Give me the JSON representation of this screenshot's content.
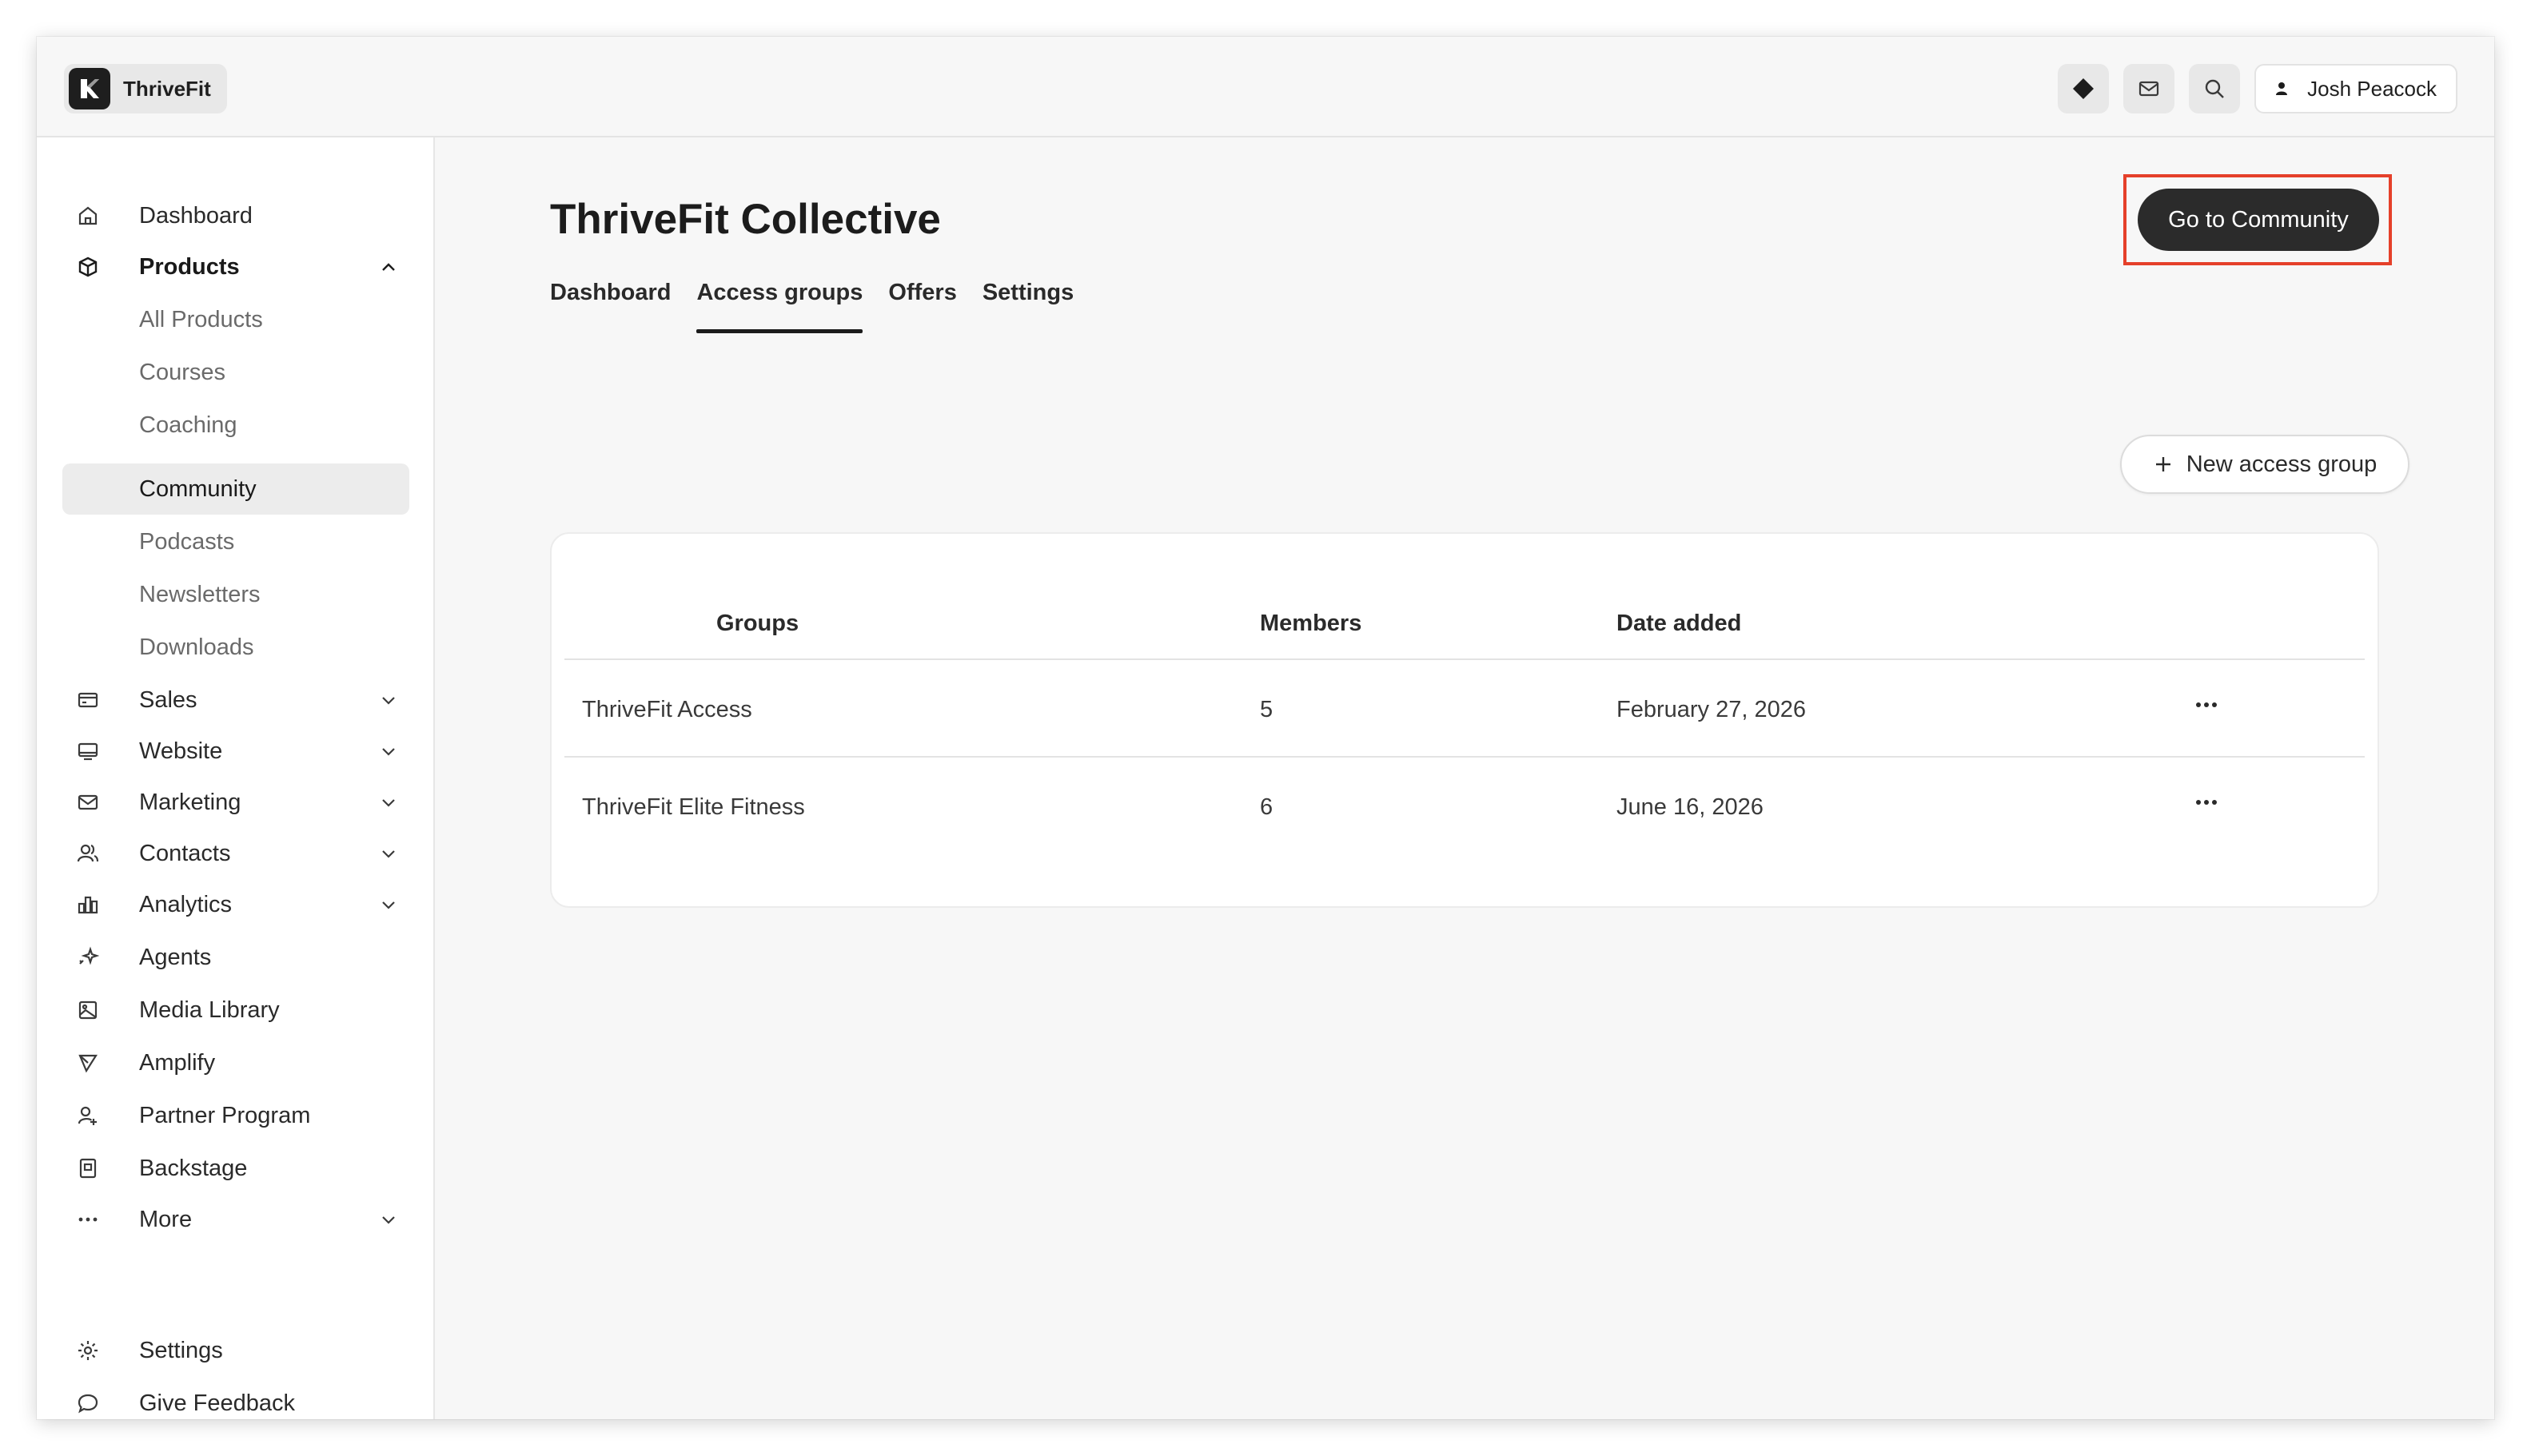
{
  "app": {
    "brand_name": "ThriveFit",
    "user_name": "Josh Peacock"
  },
  "sidebar": {
    "items": [
      {
        "label": "Dashboard",
        "icon": "home-icon"
      },
      {
        "label": "Products",
        "icon": "box-icon",
        "expanded": true
      },
      {
        "label": "Sales",
        "icon": "credit-card-icon"
      },
      {
        "label": "Website",
        "icon": "monitor-icon"
      },
      {
        "label": "Marketing",
        "icon": "mail-icon"
      },
      {
        "label": "Contacts",
        "icon": "users-icon"
      },
      {
        "label": "Analytics",
        "icon": "bar-chart-icon"
      },
      {
        "label": "Agents",
        "icon": "sparkles-icon"
      },
      {
        "label": "Media Library",
        "icon": "image-icon"
      },
      {
        "label": "Amplify",
        "icon": "send-icon"
      },
      {
        "label": "Partner Program",
        "icon": "partner-icon"
      },
      {
        "label": "Backstage",
        "icon": "backstage-icon"
      },
      {
        "label": "More",
        "icon": "more-dots-icon"
      },
      {
        "label": "Settings",
        "icon": "gear-icon"
      },
      {
        "label": "Give Feedback",
        "icon": "chat-bubble-icon"
      }
    ],
    "product_subitems": [
      "All Products",
      "Courses",
      "Coaching",
      "Community",
      "Podcasts",
      "Newsletters",
      "Downloads"
    ],
    "active_subitem": "Community"
  },
  "main": {
    "title": "ThriveFit Collective",
    "cta_label": "Go to Community",
    "tabs": [
      "Dashboard",
      "Access groups",
      "Offers",
      "Settings"
    ],
    "active_tab": "Access groups",
    "new_group_label": "New access group",
    "table": {
      "headers": [
        "Groups",
        "Members",
        "Date added"
      ],
      "rows": [
        {
          "group": "ThriveFit Access",
          "members": "5",
          "date": "February 27, 2026"
        },
        {
          "group": "ThriveFit Elite Fitness",
          "members": "6",
          "date": "June 16, 2026"
        }
      ]
    }
  },
  "colors": {
    "accent_dark": "#2b2b2b",
    "highlight_frame": "#e5402a",
    "page_bg": "#f7f7f7"
  }
}
